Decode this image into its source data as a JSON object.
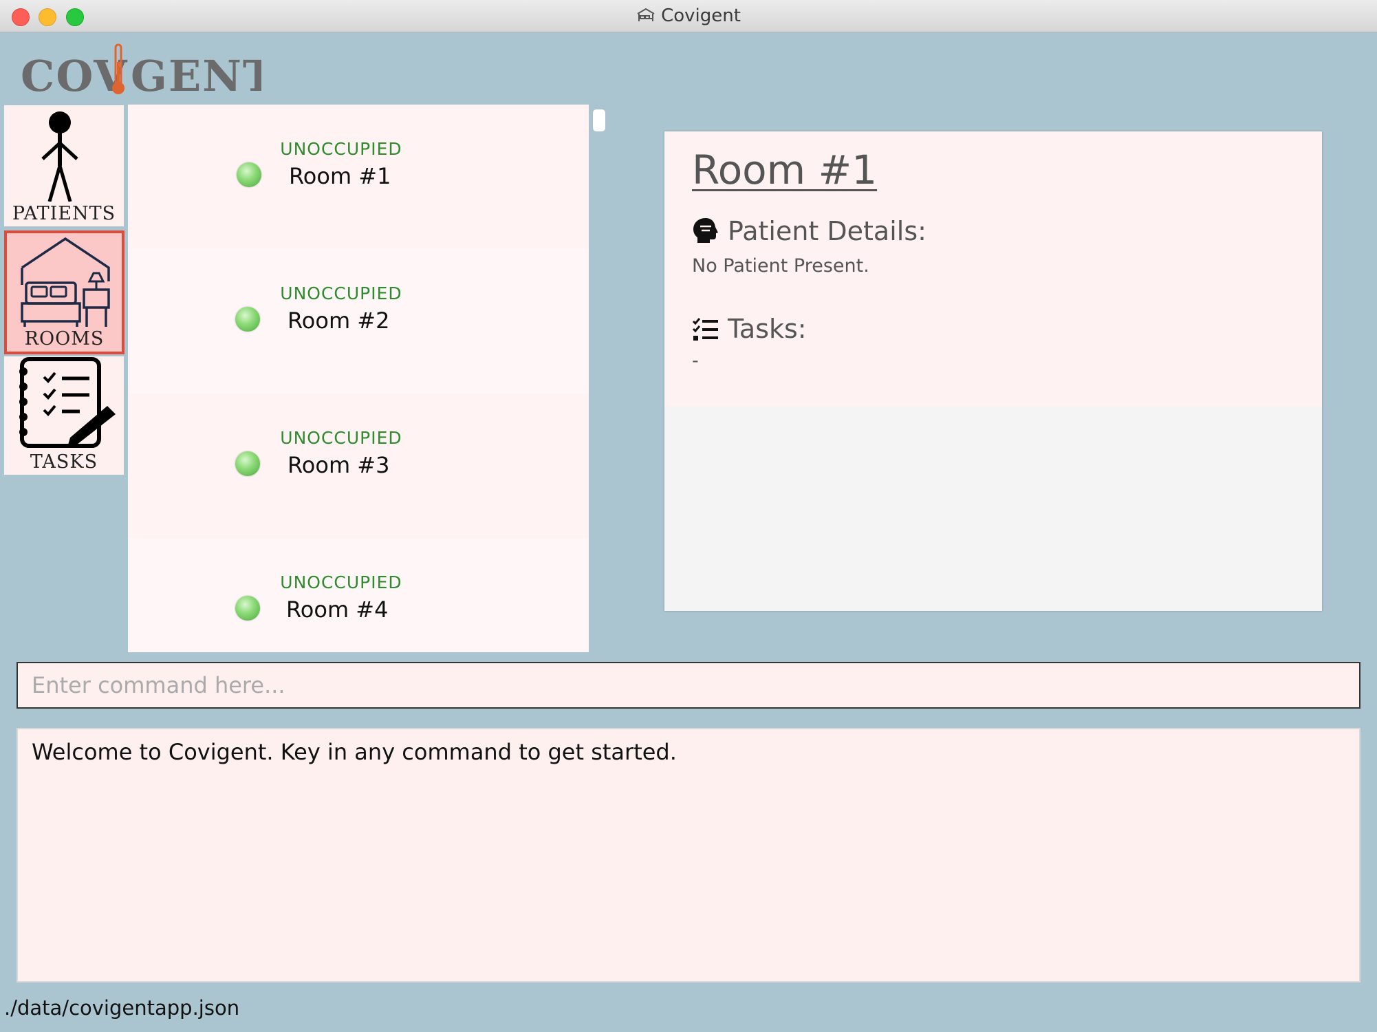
{
  "window": {
    "title": "Covigent"
  },
  "logo": {
    "text": "COVIGENT"
  },
  "nav": [
    {
      "label": "PATIENTS",
      "icon": "person-icon"
    },
    {
      "label": "ROOMS",
      "icon": "bedroom-icon",
      "selected": true
    },
    {
      "label": "TASKS",
      "icon": "checklist-icon"
    }
  ],
  "rooms": [
    {
      "status": "UNOCCUPIED",
      "name": "Room #1"
    },
    {
      "status": "UNOCCUPIED",
      "name": "Room #2"
    },
    {
      "status": "UNOCCUPIED",
      "name": "Room #3"
    },
    {
      "status": "UNOCCUPIED",
      "name": "Room #4"
    }
  ],
  "details": {
    "title": "Room #1",
    "patient_heading": "Patient Details:",
    "patient_value": "No Patient Present.",
    "tasks_heading": "Tasks:",
    "tasks_value": "-"
  },
  "command": {
    "placeholder": "Enter command here...",
    "value": ""
  },
  "result": {
    "text": "Welcome to Covigent. Key in any command to get started."
  },
  "status_bar": {
    "path": "./data/covigentapp.json"
  },
  "colors": {
    "background": "#abc5d0",
    "card": "#fff2f2",
    "selected_border": "#e04a3a",
    "status_green": "#2e8b2e"
  }
}
